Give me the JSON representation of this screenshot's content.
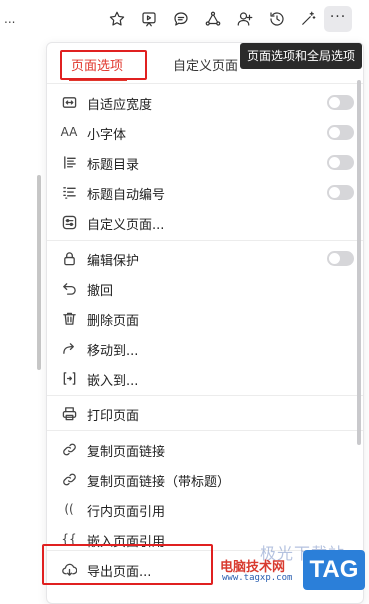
{
  "toolbar": {
    "left_ellipsis": "...",
    "icons": [
      "star-icon",
      "present-icon",
      "comment-icon",
      "share-network-icon",
      "user-icon",
      "history-icon",
      "magic-wand-icon"
    ],
    "more_label": "···"
  },
  "tooltip": {
    "text": "页面选项和全局选项"
  },
  "tabs": {
    "page_options": "页面选项",
    "custom_page": "自定义页面"
  },
  "menu": {
    "adaptive_width": "自适应宽度",
    "small_font": "小字体",
    "small_font_icon": "AA",
    "outline": "标题目录",
    "auto_numbering": "标题自动编号",
    "custom_page": "自定义页面...",
    "edit_protect": "编辑保护",
    "undo": "撤回",
    "delete_page": "删除页面",
    "move_to": "移动到...",
    "embed_to": "嵌入到...",
    "print_page": "打印页面",
    "copy_link": "复制页面链接",
    "copy_link_title": "复制页面链接（带标题）",
    "inline_ref": "行内页面引用",
    "inline_ref_icon": "((",
    "embed_ref": "嵌入页面引用",
    "embed_ref_icon": "{{",
    "export_page": "导出页面..."
  },
  "toggles": {
    "adaptive_width": false,
    "small_font": false,
    "outline": false,
    "auto_numbering": false,
    "edit_protect": false
  },
  "watermark": {
    "site_name": "电脑技术网",
    "url": "www.tagxp.com",
    "badge": "TAG",
    "faded_text": "极光下载站"
  },
  "colors": {
    "accent": "#e0362c",
    "highlight_box": "#e02020",
    "toggle_off": "#d6d6d9",
    "tooltip_bg": "#2a2a2a"
  }
}
